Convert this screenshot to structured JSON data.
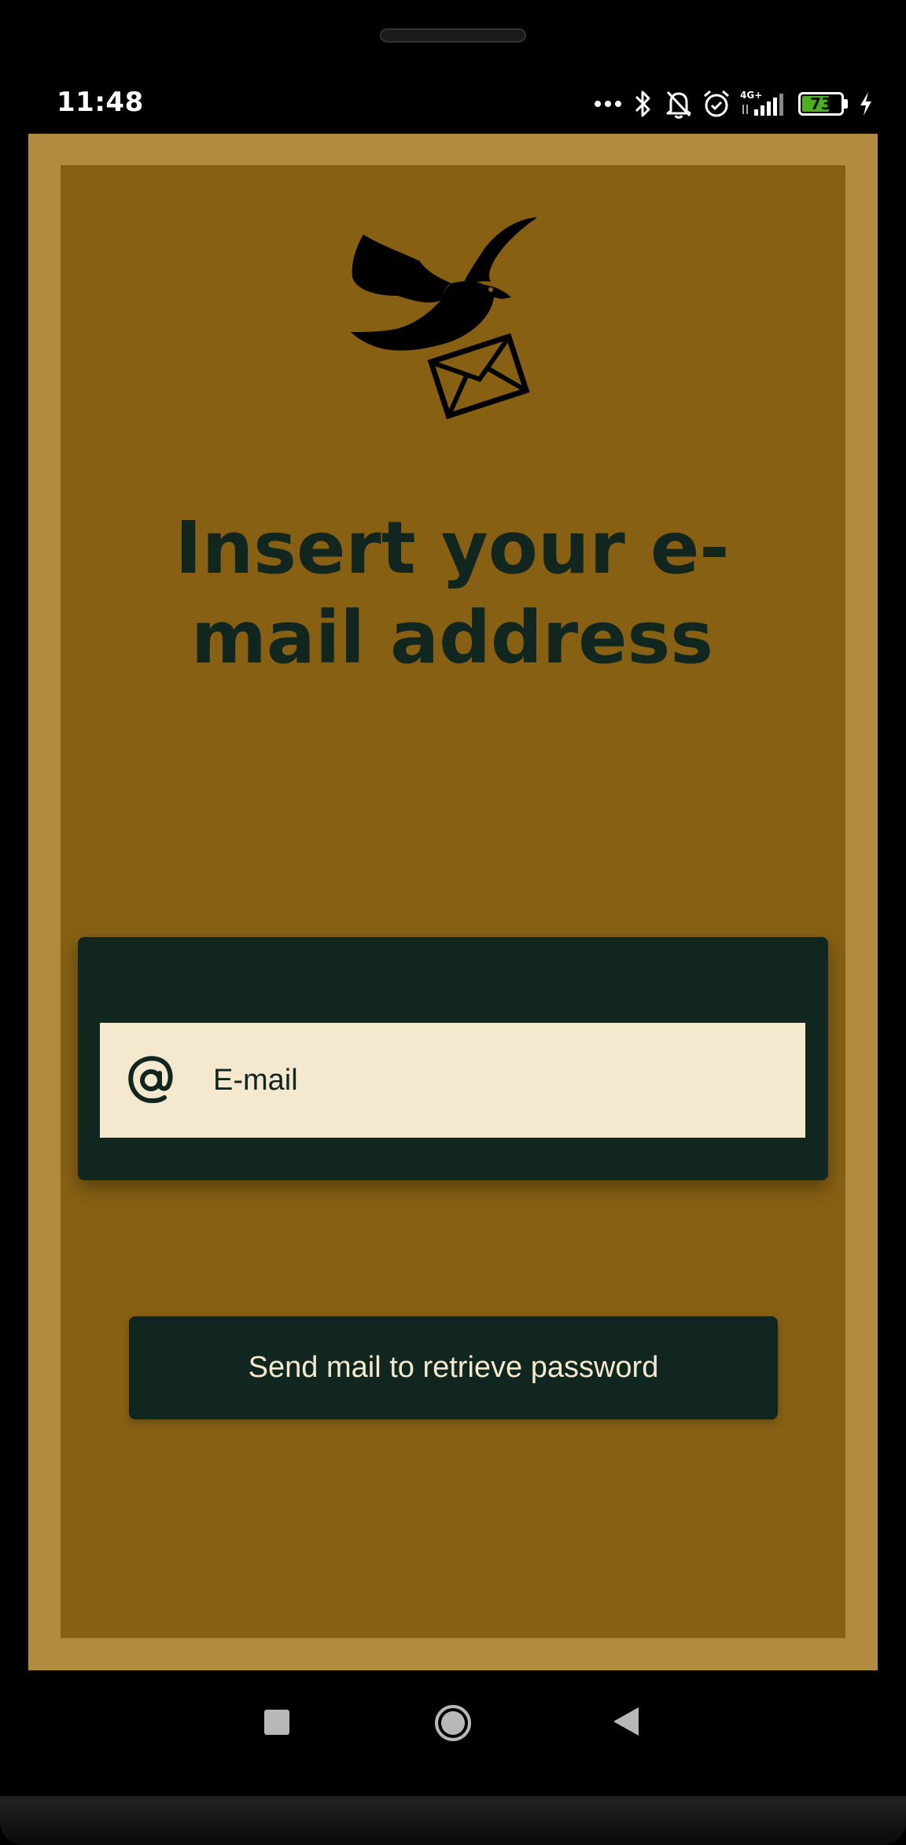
{
  "status_bar": {
    "time": "11:48",
    "network": "4G+",
    "battery_percent": "73",
    "battery_level": 0.73,
    "icons": [
      "more-dots-icon",
      "bluetooth-icon",
      "bell-off-icon",
      "alarm-icon",
      "signal-icon",
      "battery-icon",
      "charging-icon"
    ]
  },
  "logo": {
    "icon": "dove-with-envelope-icon"
  },
  "headline": "Insert your e-mail address",
  "email_field": {
    "icon": "at-sign-icon",
    "placeholder": "E-mail",
    "value": ""
  },
  "send_button": {
    "label": "Send mail to retrieve password"
  },
  "nav_bar": {
    "icons": [
      "recent-apps-icon",
      "home-icon",
      "back-icon"
    ]
  },
  "colors": {
    "screen_border": "#b38b40",
    "background": "#876014",
    "dark_green": "#122620",
    "cream": "#f4e9cf",
    "battery_green": "#4caf1e"
  }
}
